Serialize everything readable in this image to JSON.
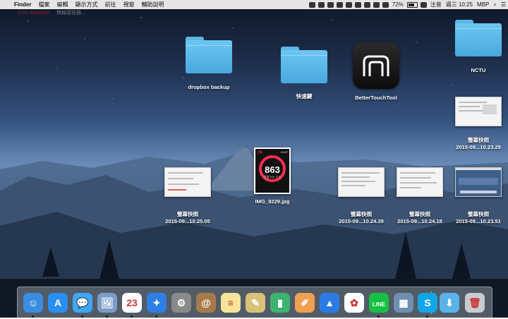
{
  "menubar": {
    "apple": "",
    "app_name": "Finder",
    "menus": [
      "檔案",
      "編輯",
      "顯示方式",
      "前往",
      "視窗",
      "輔助說明"
    ],
    "battery": "72%",
    "input_method": "注音",
    "datetime": "週三 10:25",
    "computer_name": "MBP"
  },
  "background_window": {
    "tab1": "Cost reduction",
    "tab2": "無線接收器…"
  },
  "desktop_items": [
    {
      "name": "dropbox-backup-folder",
      "label": "dropbox backup",
      "kind": "folder"
    },
    {
      "name": "shortcut-folder",
      "label": "快速鍵",
      "kind": "folder"
    },
    {
      "name": "bettertouchtool-app",
      "label": "BetterTouchTool",
      "kind": "app"
    },
    {
      "name": "nctu-folder",
      "label": "NCTU",
      "kind": "folder"
    },
    {
      "name": "screenshot-1023-29",
      "label": "螢幕快照",
      "sublabel": "2015-09...10.23.29",
      "kind": "screenshot"
    },
    {
      "name": "img-9229",
      "label": "IMG_9229.jpg",
      "kind": "photo",
      "screen_value": "863",
      "screen_time": "21:57",
      "screen_caption": "活動",
      "screen_sub": "目標 500 大卡"
    },
    {
      "name": "screenshot-1025-05",
      "label": "螢幕快照",
      "sublabel": "2015-09...10.25.05",
      "kind": "screenshot"
    },
    {
      "name": "screenshot-1024-39",
      "label": "螢幕快照",
      "sublabel": "2015-09...10.24.39",
      "kind": "screenshot"
    },
    {
      "name": "screenshot-1024-18",
      "label": "螢幕快照",
      "sublabel": "2015-09...10.24.18",
      "kind": "screenshot"
    },
    {
      "name": "screenshot-1023-51",
      "label": "螢幕快照",
      "sublabel": "2015-09...10.23.51",
      "kind": "screenshot"
    }
  ],
  "dock": {
    "apps": [
      {
        "name": "finder",
        "glyph": "☺",
        "color": "#3b8de0",
        "running": true
      },
      {
        "name": "app-store",
        "glyph": "A",
        "color": "#2a8ff0",
        "running": false
      },
      {
        "name": "messages",
        "glyph": "💬",
        "color": "#3ea6f3",
        "running": true
      },
      {
        "name": "preview",
        "glyph": "🖼",
        "color": "#7a9cc8",
        "running": true
      },
      {
        "name": "calendar",
        "glyph": "23",
        "color": "#ffffff",
        "running": true
      },
      {
        "name": "safari",
        "glyph": "✦",
        "color": "#2d7fe6",
        "running": true
      },
      {
        "name": "system-preferences",
        "glyph": "⚙",
        "color": "#8a8a8a",
        "running": false
      },
      {
        "name": "contacts",
        "glyph": "@",
        "color": "#a87a4a",
        "running": false
      },
      {
        "name": "notes",
        "glyph": "≡",
        "color": "#f6e59a",
        "running": false
      },
      {
        "name": "preview-alt",
        "glyph": "✎",
        "color": "#d8c27a",
        "running": false
      },
      {
        "name": "numbers",
        "glyph": "▮",
        "color": "#3cb371",
        "running": false
      },
      {
        "name": "pages",
        "glyph": "✐",
        "color": "#f0a050",
        "running": false
      },
      {
        "name": "keynote",
        "glyph": "▲",
        "color": "#2c7be5",
        "running": false
      },
      {
        "name": "photos",
        "glyph": "✿",
        "color": "#ffffff",
        "running": false
      },
      {
        "name": "line",
        "glyph": "LINE",
        "color": "#16c043",
        "running": true
      },
      {
        "name": "image-capture",
        "glyph": "▦",
        "color": "#6e8fb0",
        "running": false
      },
      {
        "name": "skype",
        "glyph": "S",
        "color": "#12a5e8",
        "running": true
      },
      {
        "name": "downloads-stack",
        "glyph": "⬇",
        "color": "#5ab2ea",
        "running": false
      },
      {
        "name": "trash",
        "glyph": "🗑",
        "color": "#c8ccd0",
        "running": false
      }
    ]
  }
}
